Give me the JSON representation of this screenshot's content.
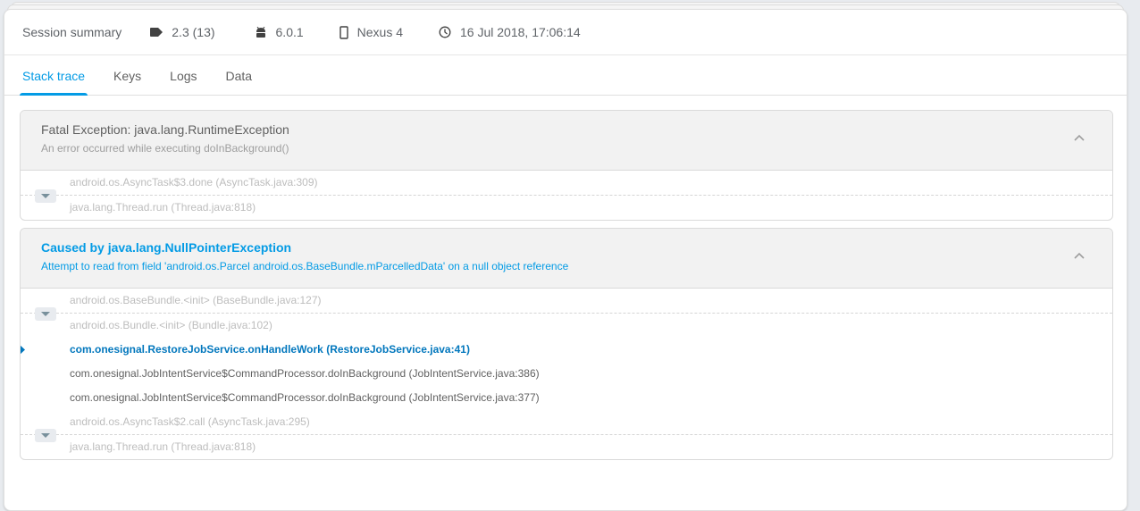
{
  "session_summary": {
    "title": "Session summary",
    "app_version": "2.3 (13)",
    "os_version": "6.0.1",
    "device": "Nexus 4",
    "timestamp": "16 Jul 2018, 17:06:14",
    "icons": [
      "tag-icon",
      "android-icon",
      "phone-icon",
      "clock-icon"
    ]
  },
  "tabs": [
    {
      "label": "Stack trace",
      "active": true
    },
    {
      "label": "Keys",
      "active": false
    },
    {
      "label": "Logs",
      "active": false
    },
    {
      "label": "Data",
      "active": false
    }
  ],
  "exceptions": [
    {
      "title": "Fatal Exception: java.lang.RuntimeException",
      "subtitle": "An error occurred while executing doInBackground()",
      "frames": [
        "android.os.AsyncTask$3.done (AsyncTask.java:309)",
        "java.lang.Thread.run (Thread.java:818)"
      ]
    },
    {
      "title": "Caused by java.lang.NullPointerException",
      "subtitle": "Attempt to read from field 'android.os.Parcel android.os.BaseBundle.mParcelledData' on a null object reference",
      "frames_top": [
        "android.os.BaseBundle.<init> (BaseBundle.java:127)",
        "android.os.Bundle.<init> (Bundle.java:102)"
      ],
      "crash_frame": "com.onesignal.RestoreJobService.onHandleWork (RestoreJobService.java:41)",
      "app_frames": [
        "com.onesignal.JobIntentService$CommandProcessor.doInBackground (JobIntentService.java:386)",
        "com.onesignal.JobIntentService$CommandProcessor.doInBackground (JobIntentService.java:377)"
      ],
      "frames_bottom": [
        "android.os.AsyncTask$2.call (AsyncTask.java:295)",
        "java.lang.Thread.run (Thread.java:818)"
      ]
    }
  ],
  "colors": {
    "accent": "#039be5",
    "crash_frame": "#0277bd",
    "muted_frame": "#bdbdbd",
    "header_bg": "#f2f2f2"
  }
}
